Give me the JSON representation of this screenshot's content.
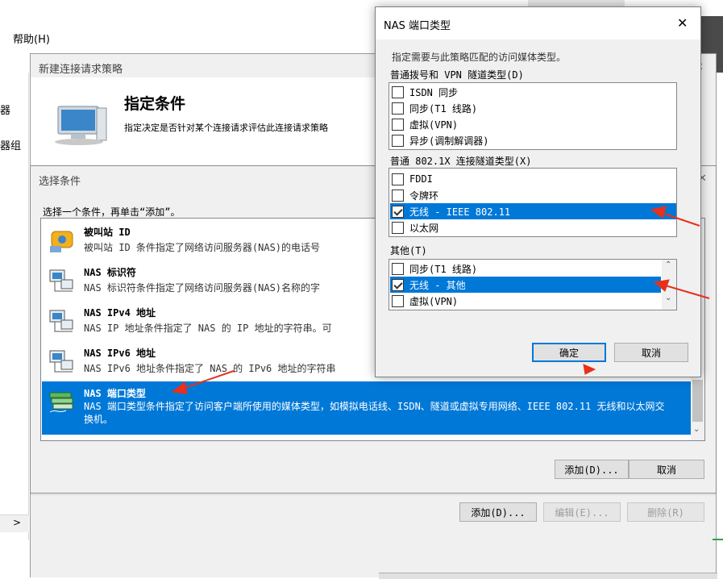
{
  "main": {
    "menu_help": "帮助(H)",
    "left_items": [
      "器",
      "器组"
    ],
    "left_scroll_right": ">"
  },
  "policy": {
    "title": "新建连接请求策略",
    "heading": "指定条件",
    "description": "指定决定是否针对某个连接请求评估此连接请求策略",
    "add_button": "添加(D)...",
    "edit_button": "编辑(E)...",
    "delete_button": "删除(R)"
  },
  "select_condition": {
    "title": "选择条件",
    "instruction": "选择一个条件，再单击“添加”。",
    "items": [
      {
        "title": "被叫站 ID",
        "desc": "被叫站 ID 条件指定了网络访问服务器(NAS)的电话号"
      },
      {
        "title": "NAS 标识符",
        "desc": "NAS 标识符条件指定了网络访问服务器(NAS)名称的字"
      },
      {
        "title": "NAS IPv4 地址",
        "desc": "NAS IP 地址条件指定了 NAS 的 IP 地址的字符串。可"
      },
      {
        "title": "NAS IPv6 地址",
        "desc": "NAS IPv6 地址条件指定了 NAS 的 IPv6 地址的字符串"
      },
      {
        "title": "NAS 端口类型",
        "desc": "NAS 端口类型条件指定了访问客户端所使用的媒体类型，如模拟电话线、ISDN、隧道或虚拟专用网络、IEEE 802.11 无线和以太网交换机。"
      }
    ],
    "add_button": "添加(D)...",
    "cancel_button": "取消"
  },
  "nas_dialog": {
    "title": "NAS 端口类型",
    "instruction": "指定需要与此策略匹配的访问媒体类型。",
    "group1_label": "普通拨号和 VPN 隧道类型(D)",
    "group1_items": [
      "ISDN 同步",
      "同步(T1 线路)",
      "虚拟(VPN)",
      "异步(调制解调器)"
    ],
    "group2_label": "普通 802.1X 连接隧道类型(X)",
    "group2_items": [
      "FDDI",
      "令牌环",
      "无线 - IEEE 802.11",
      "以太网"
    ],
    "group3_label": "其他(T)",
    "group3_items": [
      "同步(T1 线路)",
      "无线 - 其他",
      "虚拟(VPN)"
    ],
    "ok_button": "确定",
    "cancel_button": "取消"
  },
  "colors": {
    "selection": "#0078d7",
    "annotation_arrow": "#e8301c"
  }
}
